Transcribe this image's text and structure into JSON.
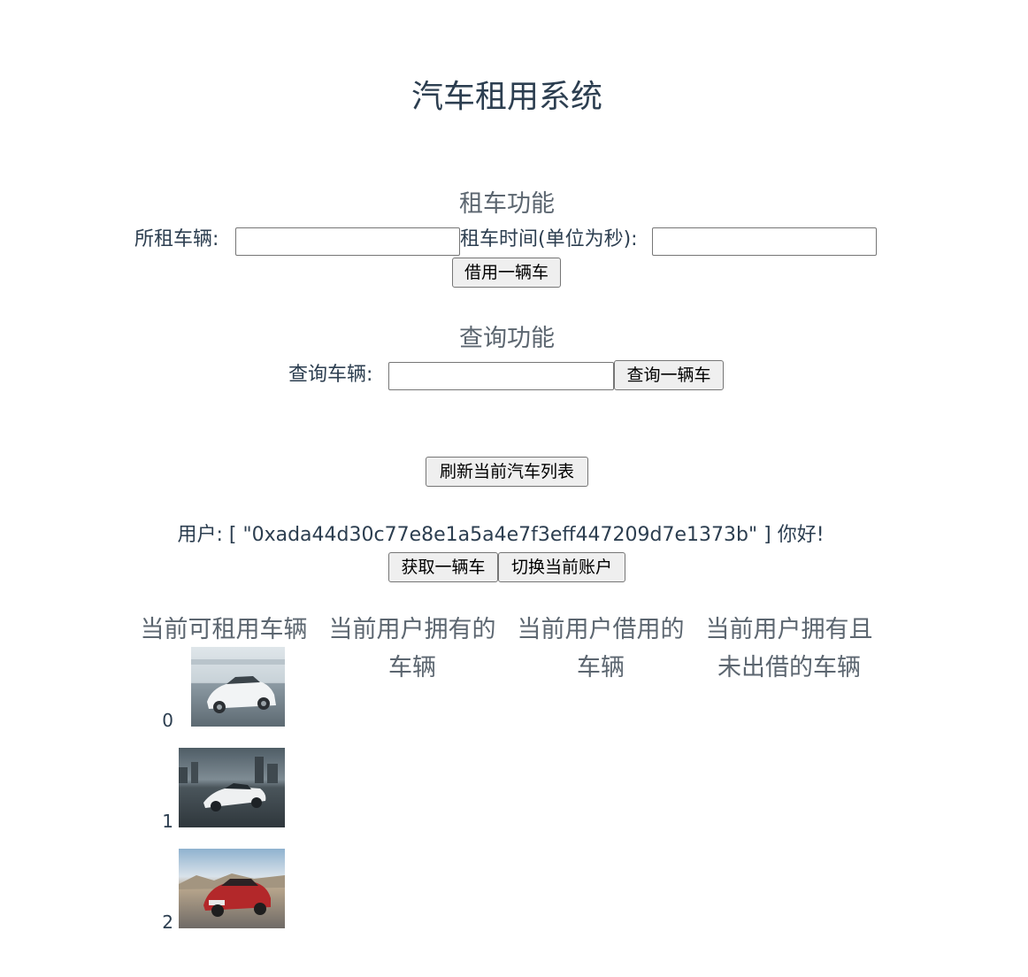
{
  "app": {
    "title": "汽车租用系统"
  },
  "rent": {
    "heading": "租车功能",
    "vehicle_label": "所租车辆:",
    "vehicle_value": "",
    "duration_label": "租车时间(单位为秒):",
    "duration_value": "",
    "submit_label": "借用一辆车"
  },
  "query": {
    "heading": "查询功能",
    "vehicle_label": "查询车辆:",
    "vehicle_value": "",
    "submit_label": "查询一辆车"
  },
  "refresh_label": "刷新当前汽车列表",
  "user": {
    "prefix": "用户: [ ",
    "address": "\"0xada44d30c77e8e1a5a4e7f3eff447209d7e1373b\"",
    "suffix": " ] 你好!",
    "get_car_label": "获取一辆车",
    "switch_account_label": "切换当前账户"
  },
  "columns": {
    "available": "当前可租用车辆",
    "owned": "当前用户拥有的车辆",
    "borrowed": "当前用户借用的车辆",
    "owned_not_lent": "当前用户拥有且未出借的车辆"
  },
  "cars": [
    {
      "index": "0",
      "image": "porsche-panamera-white-photo"
    },
    {
      "index": "1",
      "image": "lamborghini-aventador-white-photo"
    },
    {
      "index": "2",
      "image": "bmw-x4-red-photo"
    }
  ]
}
